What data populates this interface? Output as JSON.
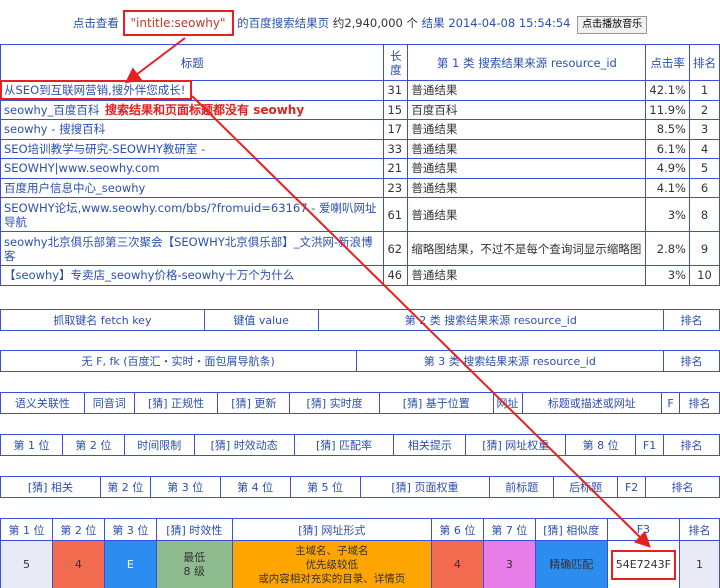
{
  "header": {
    "prefix": "点击查看",
    "keyword": "\"intitle:seowhy\"",
    "middle": "的百度搜索结果页",
    "count": "约2,940,000 个",
    "result_link": "结果",
    "date": "2014-04-08 15:54:54",
    "music_button": "点击播放音乐"
  },
  "results": {
    "columns": [
      "标题",
      "长度",
      "第 1 类 搜索结果来源 resource_id",
      "点击率",
      "排名"
    ],
    "rows": [
      {
        "title": "从SEO到互联网营销,搜外伴您成长!",
        "len": "31",
        "src": "普通结果",
        "ctr": "42.1%",
        "rank": "1"
      },
      {
        "title": "seowhy_百度百科",
        "len": "15",
        "src": "百度百科",
        "ctr": "11.9%",
        "rank": "2"
      },
      {
        "title": "seowhy - 搜搜百科",
        "len": "17",
        "src": "普通结果",
        "ctr": "8.5%",
        "rank": "3"
      },
      {
        "title": "SEO培训教学与研究-SEOWHY教研室 -",
        "len": "33",
        "src": "普通结果",
        "ctr": "6.1%",
        "rank": "4"
      },
      {
        "title": "SEOWHY|www.seowhy.com",
        "len": "21",
        "src": "普通结果",
        "ctr": "4.9%",
        "rank": "5"
      },
      {
        "title": "百度用户信息中心_seowhy",
        "len": "23",
        "src": "普通结果",
        "ctr": "4.1%",
        "rank": "6"
      },
      {
        "title": "SEOWHY论坛,www.seowhy.com/bbs/?fromuid=63167 - 爱喇叭网址导航",
        "len": "61",
        "src": "普通结果",
        "ctr": "3%",
        "rank": "8"
      },
      {
        "title": "seowhy北京俱乐部第三次聚会【SEOWHY北京俱乐部】_文洪网-新浪博客",
        "len": "62",
        "src": "缩略图结果，不过不是每个查询词显示缩略图",
        "ctr": "2.8%",
        "rank": "9"
      },
      {
        "title": "【seowhy】专卖店_seowhy价格-seowhy十万个为什么",
        "len": "46",
        "src": "普通结果",
        "ctr": "3%",
        "rank": "10"
      }
    ],
    "annotation": "搜索结果和页面标题都没有 seowhy"
  },
  "table2": {
    "c1": "抓取键名 fetch key",
    "c2": "键值 value",
    "c3": "第 2 类 搜索结果来源 resource_id",
    "c4": "排名"
  },
  "table3": {
    "c1": "无 F, fk (百度汇・实时・面包屑导航条)",
    "c2": "第 3 类 搜索结果来源 resource_id",
    "c3": "排名"
  },
  "table4": {
    "cells": [
      "语义关联性",
      "同音词",
      "[猜] 正规性",
      "[猜] 更新",
      "[猜] 实时度",
      "[猜] 基于位置",
      "网址",
      "标题或描述或网址",
      "F",
      "排名"
    ]
  },
  "table5": {
    "cells": [
      "第 1 位",
      "第 2 位",
      "时间限制",
      "[猜] 时效动态",
      "[猜] 匹配率",
      "相关提示",
      "[猜] 网址权重",
      "第 8 位",
      "F1",
      "排名"
    ]
  },
  "table6": {
    "cells": [
      "[猜] 相关",
      "第 2 位",
      "第 3 位",
      "第 4 位",
      "第 5 位",
      "[猜] 页面权重",
      "前标题",
      "后标题",
      "F2",
      "排名"
    ]
  },
  "table7": {
    "head": [
      "第 1 位",
      "第 2 位",
      "第 3 位",
      "[猜] 时效性",
      "[猜] 网址形式",
      "第 6 位",
      "第 7 位",
      "[猜] 相似度",
      "F3",
      "排名"
    ],
    "vals": [
      "5",
      "4",
      "E",
      "最低\n8 级",
      "主域名、子域名\n优先级较低\n或内容相对充实的目录、详情页",
      "4",
      "3",
      "精确匹配",
      "54E7243F",
      "1"
    ],
    "colors": [
      "#e8eaf6",
      "#f36b4f",
      "#2d8cf0",
      "#8fbc8f",
      "#ffa500",
      "#f36b4f",
      "#e77ee7",
      "#2d8cf0",
      "#ffffff",
      "#e8eaf6"
    ]
  }
}
